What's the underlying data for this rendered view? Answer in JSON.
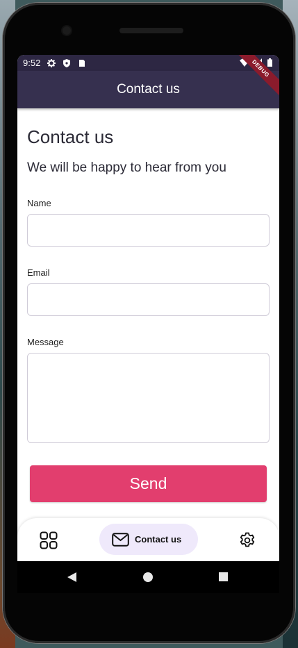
{
  "status": {
    "time": "9:52"
  },
  "appbar": {
    "title": "Contact us"
  },
  "ribbon": {
    "text": "DEBUG"
  },
  "form": {
    "heading": "Contact us",
    "subheading": "We will be happy to hear from you",
    "name_label": "Name",
    "name_value": "",
    "email_label": "Email",
    "email_value": "",
    "message_label": "Message",
    "message_value": "",
    "send_label": "Send"
  },
  "bottom_nav": {
    "items": [
      {
        "icon": "grid-icon",
        "label": ""
      },
      {
        "icon": "mail-icon",
        "label": "Contact us",
        "active": true
      },
      {
        "icon": "gear-icon",
        "label": ""
      }
    ]
  },
  "colors": {
    "appbar": "#36304f",
    "statusbar": "#2d2743",
    "send_button": "#e23e6e",
    "active_nav_pill": "#efe9fb"
  }
}
